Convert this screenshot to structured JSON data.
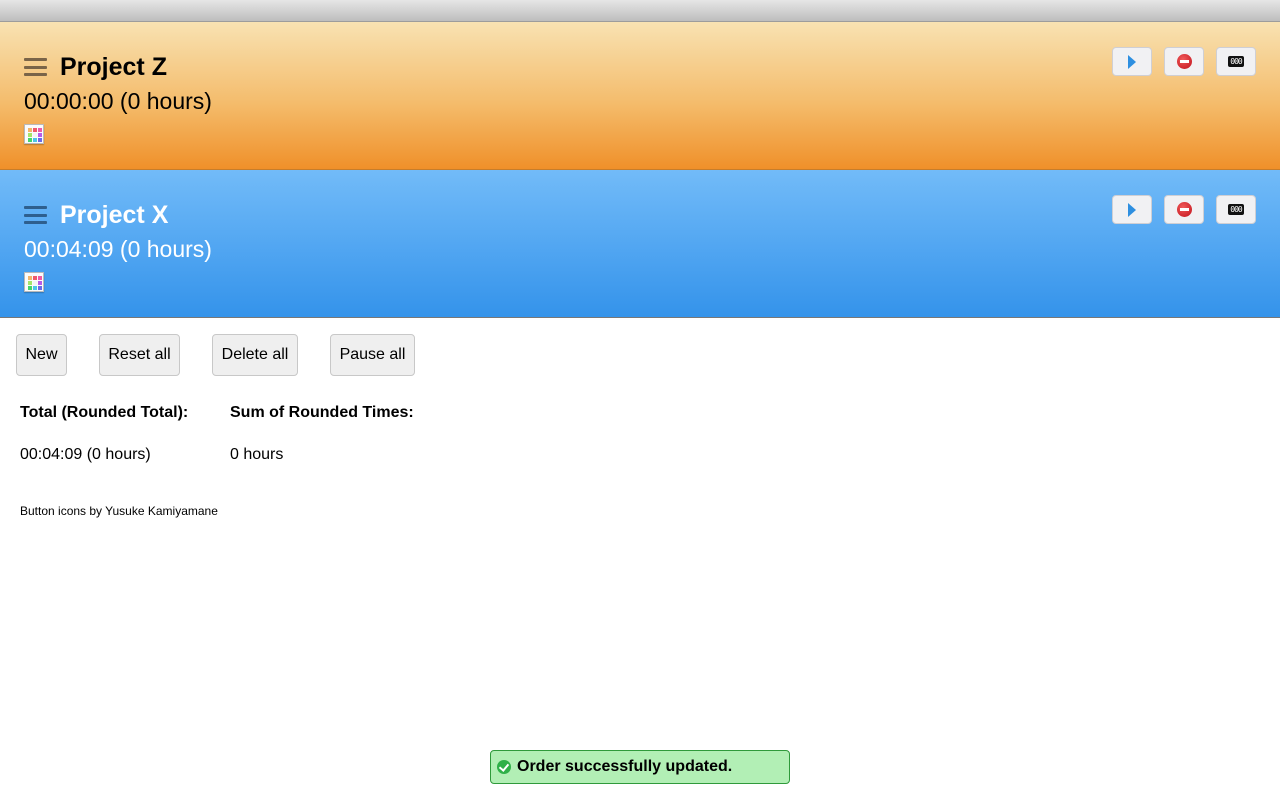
{
  "projects": [
    {
      "name": "Project Z",
      "timer": "00:00:00 (0 hours)",
      "color_theme": "orange"
    },
    {
      "name": "Project X",
      "timer": "00:04:09 (0 hours)",
      "color_theme": "blue"
    }
  ],
  "project_controls": {
    "start_icon": "play-icon",
    "delete_icon": "stop-icon",
    "reset_icon": "counter-reset-icon",
    "reset_glyph": "000"
  },
  "actions": {
    "new_label": "New",
    "reset_all_label": "Reset all",
    "delete_all_label": "Delete all",
    "pause_all_label": "Pause all"
  },
  "totals": {
    "total_header": "Total (Rounded Total):",
    "total_value": "00:04:09 (0 hours)",
    "sum_header": "Sum of Rounded Times:",
    "sum_value": "0 hours"
  },
  "credits": "Button icons by Yusuke Kamiyamane",
  "toast": {
    "message": "Order successfully updated.",
    "status": "success"
  },
  "colors": {
    "orange_accent": "#f0902a",
    "blue_accent": "#3493ea",
    "toast_bg": "#b2efb5"
  }
}
